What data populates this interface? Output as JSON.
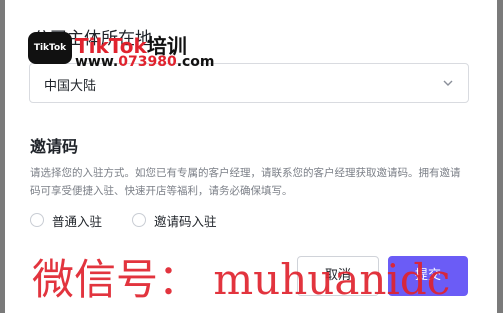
{
  "form": {
    "region_label": "公司主体所在地",
    "region_value": "中国大陆",
    "invite_heading": "邀请码",
    "invite_desc": "请选择您的入驻方式。如您已有专属的客户经理，请联系您的客户经理获取邀请码。拥有邀请码可享受便捷入驻、快速开店等福利，请务必确保填写。",
    "options": [
      {
        "label": "普通入驻",
        "selected": false
      },
      {
        "label": "邀请码入驻",
        "selected": false
      }
    ],
    "cancel_label": "取消",
    "submit_label": "提交"
  },
  "watermark": {
    "logo_text": "TikTok",
    "brand_text_red": "TikTok",
    "brand_text_black": "培训",
    "site_prefix": "www.",
    "site_red": "073980",
    "site_suffix": ".com",
    "wechat_text": "微信号： muhuanidc"
  },
  "colors": {
    "accent": "#6b5cf6",
    "watermark_red": "#e0232e"
  }
}
